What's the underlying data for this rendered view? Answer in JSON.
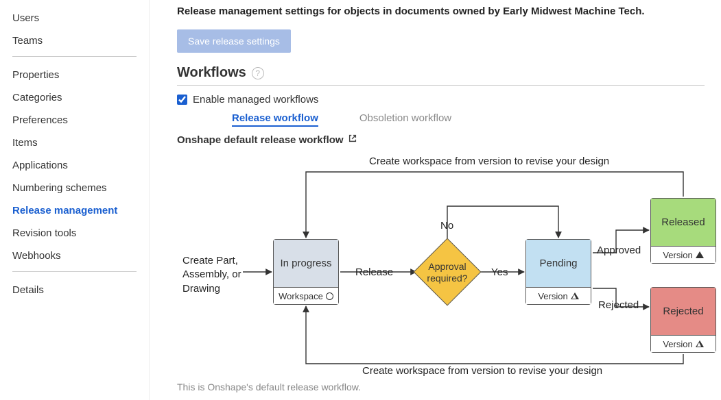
{
  "sidebar": {
    "g1": [
      "Users",
      "Teams"
    ],
    "g2": [
      "Properties",
      "Categories",
      "Preferences",
      "Items",
      "Applications",
      "Numbering schemes",
      "Release management",
      "Revision tools",
      "Webhooks"
    ],
    "g3": [
      "Details"
    ],
    "active": "Release management"
  },
  "main": {
    "heading": "Release management settings for objects in documents owned by Early Midwest Machine Tech.",
    "save_label": "Save release settings",
    "section_title": "Workflows",
    "checkbox_label": "Enable managed workflows",
    "checkbox_checked": true,
    "tabs": {
      "release": "Release workflow",
      "obsoletion": "Obsoletion workflow"
    },
    "subheading": "Onshape default release workflow",
    "caption": "This is Onshape's default release workflow."
  },
  "diagram": {
    "create_label": "Create Part, Assembly, or Drawing",
    "in_progress": {
      "title": "In progress",
      "foot": "Workspace"
    },
    "pending": {
      "title": "Pending",
      "foot": "Version"
    },
    "released": {
      "title": "Released",
      "foot": "Version"
    },
    "rejected": {
      "title": "Rejected",
      "foot": "Version"
    },
    "decision": "Approval required?",
    "release": "Release",
    "no": "No",
    "yes": "Yes",
    "approved": "Approved",
    "rejected_label": "Rejected",
    "revise_top": "Create workspace from version to revise your design",
    "revise_bottom": "Create workspace from version to revise your design"
  }
}
